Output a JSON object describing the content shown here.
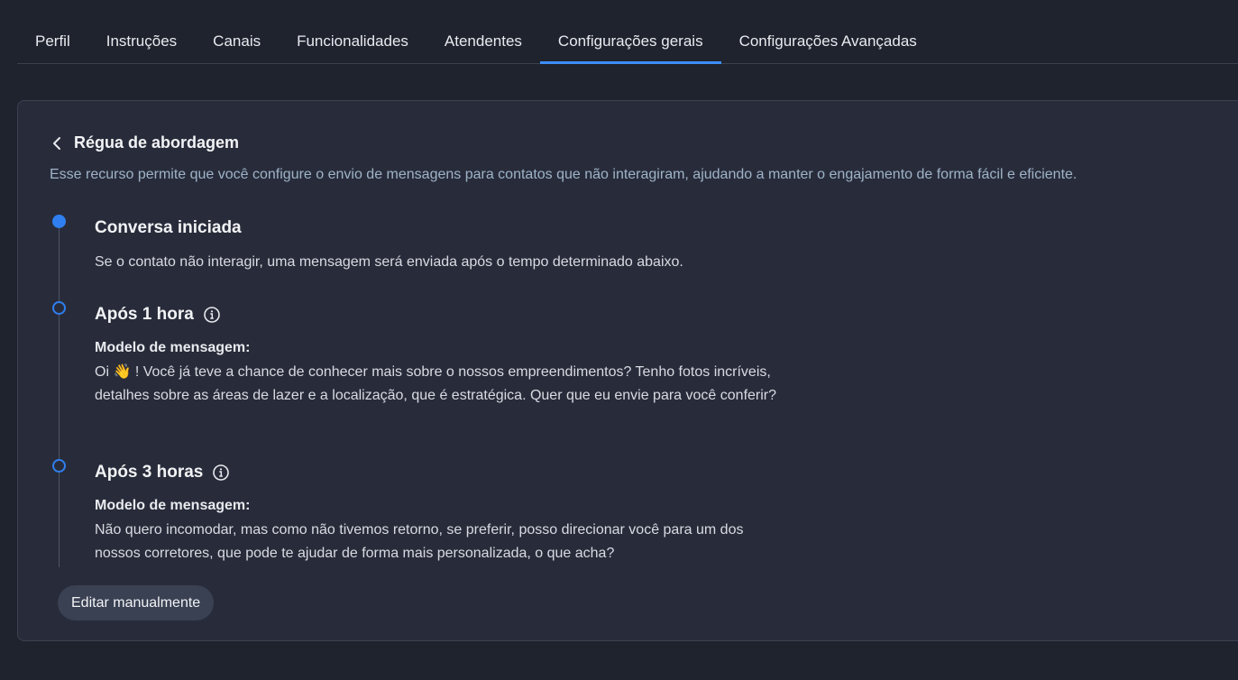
{
  "tabs": [
    {
      "label": "Perfil",
      "active": false
    },
    {
      "label": "Instruções",
      "active": false
    },
    {
      "label": "Canais",
      "active": false
    },
    {
      "label": "Funcionalidades",
      "active": false
    },
    {
      "label": "Atendentes",
      "active": false
    },
    {
      "label": "Configurações gerais",
      "active": true
    },
    {
      "label": "Configurações Avançadas",
      "active": false
    }
  ],
  "page": {
    "title": "Régua de abordagem",
    "description": "Esse recurso permite que você configure o envio de mensagens para contatos que não interagiram, ajudando a manter o engajamento de forma fácil e eficiente."
  },
  "steps": [
    {
      "title": "Conversa iniciada",
      "text": "Se o contato não interagir, uma mensagem será enviada após o tempo determinado abaixo."
    },
    {
      "title": "Após 1 hora",
      "label": "Modelo de mensagem:",
      "text": "Oi 👋 ! Você já teve a chance de conhecer mais sobre o nossos empreendimentos? Tenho fotos incríveis, detalhes sobre as áreas de lazer e a localização, que é estratégica. Quer que eu envie para você conferir?"
    },
    {
      "title": "Após 3 horas",
      "label": "Modelo de mensagem:",
      "text": "Não quero incomodar, mas como não tivemos retorno, se preferir, posso direcionar você para um dos nossos corretores, que pode te ajudar de forma mais personalizada, o que acha?"
    }
  ],
  "actions": {
    "edit_label": "Editar manualmente"
  },
  "colors": {
    "accent": "#2f7ff0",
    "background": "#1f232e",
    "panel": "#282c3a"
  }
}
